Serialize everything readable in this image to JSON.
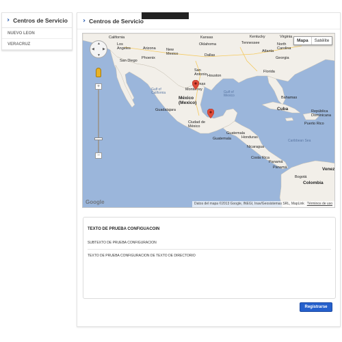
{
  "sidebar": {
    "title": "Centros de Servicio",
    "items": [
      {
        "label": "NUEVO LEON"
      },
      {
        "label": "VERACRUZ"
      }
    ]
  },
  "main": {
    "title": "Centros de Servicio"
  },
  "map": {
    "type_controls": [
      "Mapa",
      "Satélite"
    ],
    "footer_text": "Datos del mapa ©2013 Google, INEGI, Inav/Geosistemas SRL, MapLink",
    "terms_link": "Términos de uso",
    "google_logo": "Google",
    "zoom_in": "+",
    "zoom_out": "−",
    "labels": {
      "california": "California",
      "kansas": "Kansas",
      "kentucky": "Kentucky",
      "virginia": "Virginia",
      "angeles": "Los\nAngeles",
      "arizona": "Arizona",
      "new_mexico": "New\nMexico",
      "oklahoma": "Oklahoma",
      "tennessee": "Tennessee",
      "n_carolina": "North\nCarolina",
      "san_diego": "San Diego",
      "phoenix": "Phoenix",
      "dallas": "Dallas",
      "atlanta": "Atlanta",
      "georgia": "Georgia",
      "san_antonio": "San\nAntonio",
      "houston": "Houston",
      "texas": "Texas",
      "florida": "Florida",
      "gulf_california": "Gulf of\nCalifornia",
      "monterrey": "Monterrey",
      "gulf_mexico": "Gulf of\nMexico",
      "bahamas": "Bahamas",
      "mexico": "México\n(Mexico)",
      "cuba": "Cuba",
      "guadalajara": "Guadalajara",
      "ciudad_mexico": "Ciudad de\nMéxico",
      "rep_dom": "República\nDominicana",
      "puerto_rico": "Puerto Rico",
      "guatemala": "Guatemala",
      "guatemala_city": "Guatemala",
      "honduras": "Honduras",
      "nicaragua": "Nicaragua",
      "caribbean": "Caribbean Sea",
      "costa_rica": "Costa Rica",
      "panama": "Panamá",
      "panama_city": "Panamá",
      "venezuela": "Venez",
      "bogota": "Bogotá",
      "colombia": "Colombia"
    }
  },
  "info": {
    "title": "TEXTO DE PRUEBA CONFIGUACOIN",
    "subtitle": "SUBTEXTO DE PRUEBA CONFIGURACION",
    "body": "TEXTO DE PRUEBA CONFIGURACION DE TEXTO DE DIRECTORIO"
  },
  "register_button": "Registrarse",
  "colors": {
    "accent": "#2560cc",
    "water": "#9bb6db",
    "land": "#f2efe9",
    "marker": "#dd4b39"
  }
}
